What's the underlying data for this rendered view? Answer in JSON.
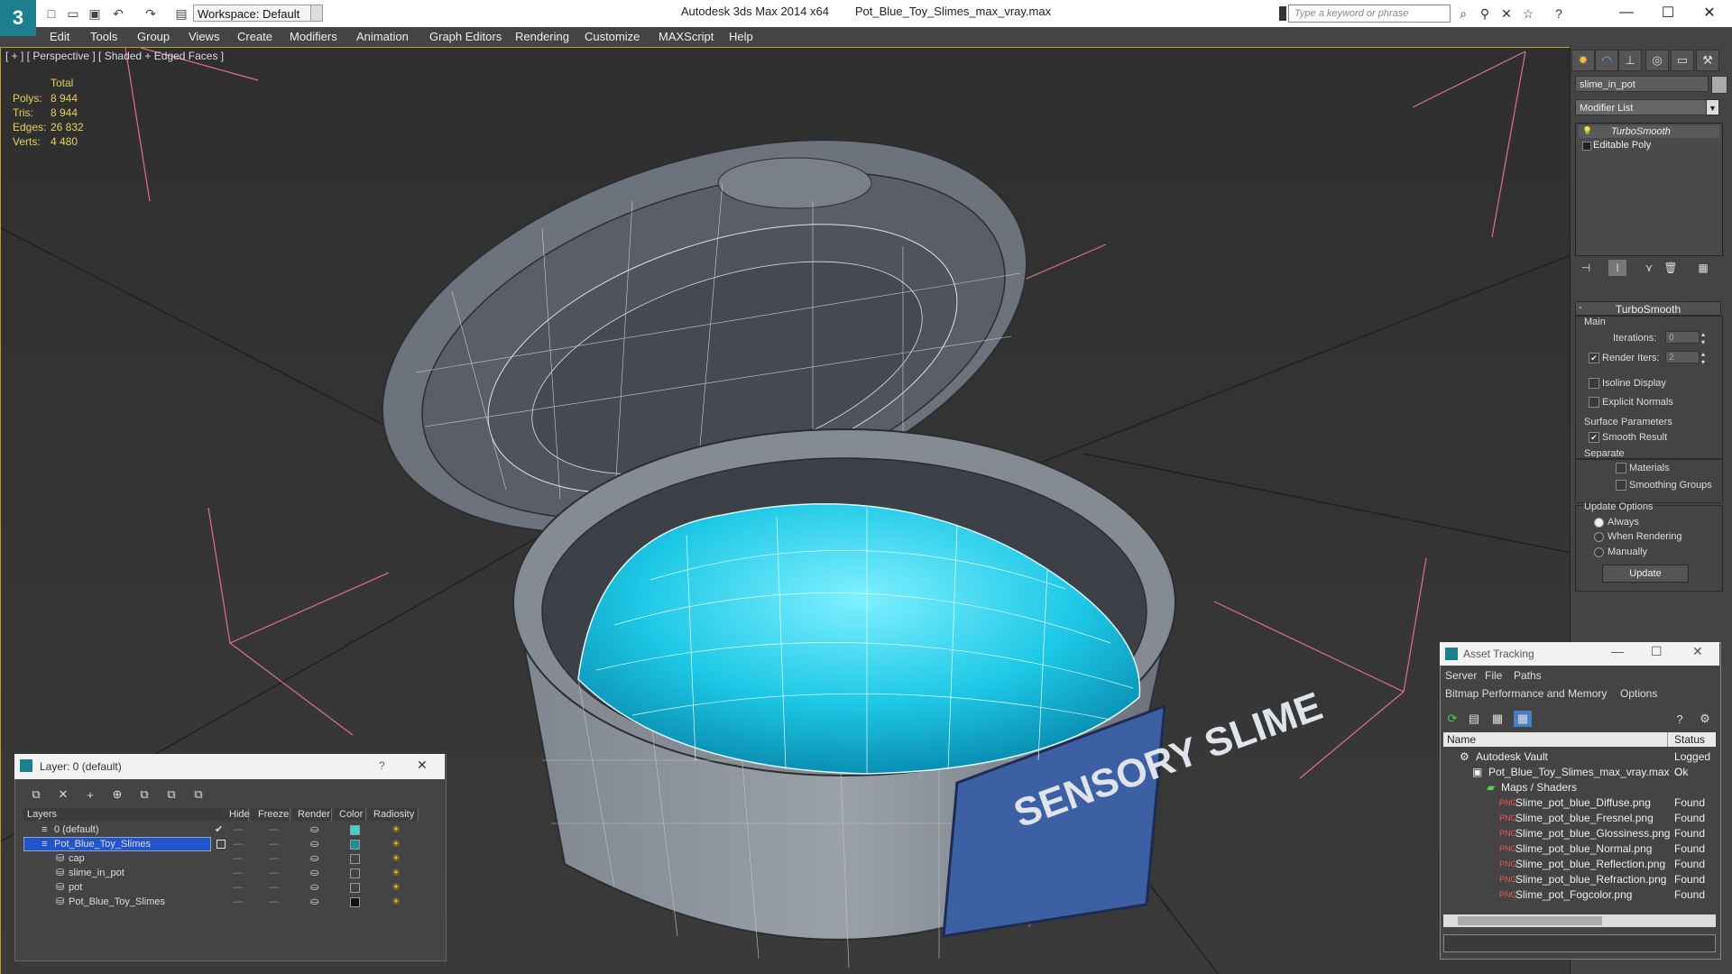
{
  "title": {
    "app": "Autodesk 3ds Max 2014 x64",
    "file": "Pot_Blue_Toy_Slimes_max_vray.max",
    "workspace": "Workspace: Default",
    "search_placeholder": "Type a keyword or phrase"
  },
  "menu": [
    "Edit",
    "Tools",
    "Group",
    "Views",
    "Create",
    "Modifiers",
    "Animation",
    "Graph Editors",
    "Rendering",
    "Customize",
    "MAXScript",
    "Help"
  ],
  "viewport": {
    "label": "[ + ] [ Perspective ] [ Shaded + Edged Faces ]",
    "stats": {
      "header": "Total",
      "rows": [
        {
          "label": "Polys:",
          "value": "8 944"
        },
        {
          "label": "Tris:",
          "value": "8 944"
        },
        {
          "label": "Edges:",
          "value": "26 832"
        },
        {
          "label": "Verts:",
          "value": "4 480"
        }
      ]
    },
    "label_text": "SENSORY SLIME"
  },
  "command_panel": {
    "object_name": "slime_in_pot",
    "modifier_list": "Modifier List",
    "stack": [
      "TurboSmooth",
      "Editable Poly"
    ],
    "rollout_title": "TurboSmooth",
    "main_group": "Main",
    "iterations_label": "Iterations:",
    "iterations_value": "0",
    "render_iters_label": "Render Iters:",
    "render_iters_value": "2",
    "isoline": "Isoline Display",
    "explicit_normals": "Explicit Normals",
    "surface_group": "Surface Parameters",
    "smooth_result": "Smooth Result",
    "separate": "Separate",
    "materials": "Materials",
    "smoothing_groups": "Smoothing Groups",
    "update_group": "Update Options",
    "always": "Always",
    "when_rendering": "When Rendering",
    "manually": "Manually",
    "update_button": "Update"
  },
  "layer_window": {
    "title": "Layer: 0 (default)",
    "help": "?",
    "columns": [
      "Layers",
      "Hide",
      "Freeze",
      "Render",
      "Color",
      "Radiosity"
    ],
    "rows": [
      {
        "name": "0 (default)",
        "color": "#3fd0d0"
      },
      {
        "name": "Pot_Blue_Toy_Slimes",
        "color": "#1a8f9a"
      },
      {
        "name": "cap",
        "color": "#444444"
      },
      {
        "name": "slime_in_pot",
        "color": "#444444"
      },
      {
        "name": "pot",
        "color": "#444444"
      },
      {
        "name": "Pot_Blue_Toy_Slimes",
        "color": "#111111"
      }
    ]
  },
  "asset_window": {
    "title": "Asset Tracking",
    "menu1": [
      "Server",
      "File",
      "Paths"
    ],
    "menu2": [
      "Bitmap Performance and Memory",
      "Options"
    ],
    "columns": [
      "Name",
      "Status"
    ],
    "rows": [
      {
        "name": "Autodesk Vault",
        "status": "Logged O"
      },
      {
        "name": "Pot_Blue_Toy_Slimes_max_vray.max",
        "status": "Ok"
      },
      {
        "name": "Maps / Shaders",
        "status": ""
      },
      {
        "name": "Slime_pot_blue_Diffuse.png",
        "status": "Found"
      },
      {
        "name": "Slime_pot_blue_Fresnel.png",
        "status": "Found"
      },
      {
        "name": "Slime_pot_blue_Glossiness.png",
        "status": "Found"
      },
      {
        "name": "Slime_pot_blue_Normal.png",
        "status": "Found"
      },
      {
        "name": "Slime_pot_blue_Reflection.png",
        "status": "Found"
      },
      {
        "name": "Slime_pot_blue_Refraction.png",
        "status": "Found"
      },
      {
        "name": "Slime_pot_Fogcolor.png",
        "status": "Found"
      }
    ]
  }
}
